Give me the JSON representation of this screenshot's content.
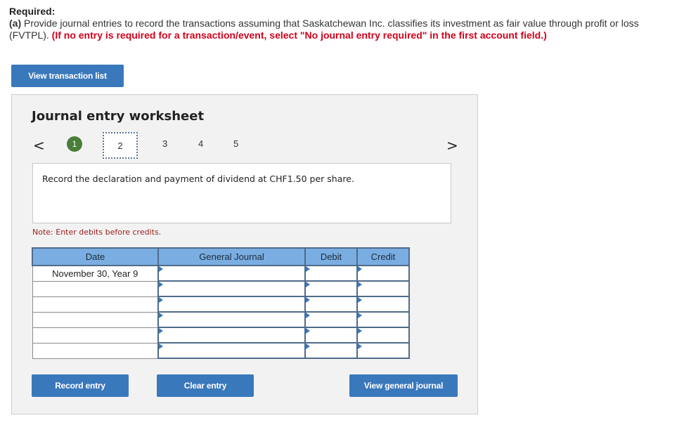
{
  "required": {
    "title": "Required:",
    "part_label": "(a)",
    "instruction": " Provide journal entries to record the transactions assuming that Saskatchewan Inc. classifies its investment as fair value through profit or loss (FVTPL). ",
    "warning": "(If no entry is required for a transaction/event, select \"No journal entry required\" in the first account field.)"
  },
  "buttons": {
    "view_transaction_list": "View transaction list",
    "record_entry": "Record entry",
    "clear_entry": "Clear entry",
    "view_general_journal": "View general journal"
  },
  "worksheet": {
    "title": "Journal entry worksheet",
    "pages": [
      "1",
      "2",
      "3",
      "4",
      "5"
    ],
    "completed_page": "1",
    "current_page": "2",
    "prev_icon": "<",
    "next_icon": ">",
    "description": "Record the declaration and payment of dividend at CHF1.50 per share.",
    "note": "Note: Enter debits before credits."
  },
  "table": {
    "headers": [
      "Date",
      "General Journal",
      "Debit",
      "Credit"
    ],
    "rows": [
      {
        "date": "November 30, Year 9",
        "account": "",
        "debit": "",
        "credit": ""
      },
      {
        "date": "",
        "account": "",
        "debit": "",
        "credit": ""
      },
      {
        "date": "",
        "account": "",
        "debit": "",
        "credit": ""
      },
      {
        "date": "",
        "account": "",
        "debit": "",
        "credit": ""
      },
      {
        "date": "",
        "account": "",
        "debit": "",
        "credit": ""
      },
      {
        "date": "",
        "account": "",
        "debit": "",
        "credit": ""
      }
    ]
  },
  "colors": {
    "button_blue": "#3a78bc",
    "header_blue": "#7aaee3",
    "completed_green": "#4a7c3a",
    "warning_red": "#d0021b",
    "note_red": "#9b1b1b"
  }
}
